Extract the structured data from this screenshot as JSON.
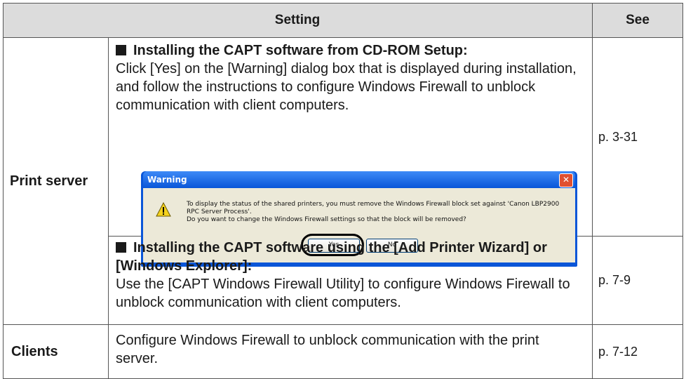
{
  "header": {
    "setting": "Setting",
    "see": "See"
  },
  "rows": {
    "print_server": {
      "label": "Print server",
      "cd_rom": {
        "title": "Installing the CAPT software from CD-ROM Setup:",
        "body": "Click [Yes] on the [Warning] dialog box that is displayed during installation, and follow the instructions to configure Windows Firewall to unblock communication with client computers.",
        "see": "p. 3-31"
      },
      "wizard": {
        "title": "Installing the CAPT software using the [Add Printer Wizard] or [Windows Explorer]:",
        "body": "Use the [CAPT Windows Firewall Utility] to configure Windows Firewall to unblock communication with client computers.",
        "see": "p. 7-9"
      }
    },
    "clients": {
      "label": "Clients",
      "body": "Configure Windows Firewall to unblock communication with the print server.",
      "see": "p. 7-12"
    }
  },
  "dialog": {
    "title": "Warning",
    "close": "✕",
    "message_line1": "To display the status of the shared printers, you must remove the Windows Firewall block set against 'Canon LBP2900 RPC Server Process'.",
    "message_line2": "Do you want to change the Windows Firewall settings so that the block will be removed?",
    "yes": "Yes",
    "no": "No",
    "icon": "warning-icon"
  }
}
